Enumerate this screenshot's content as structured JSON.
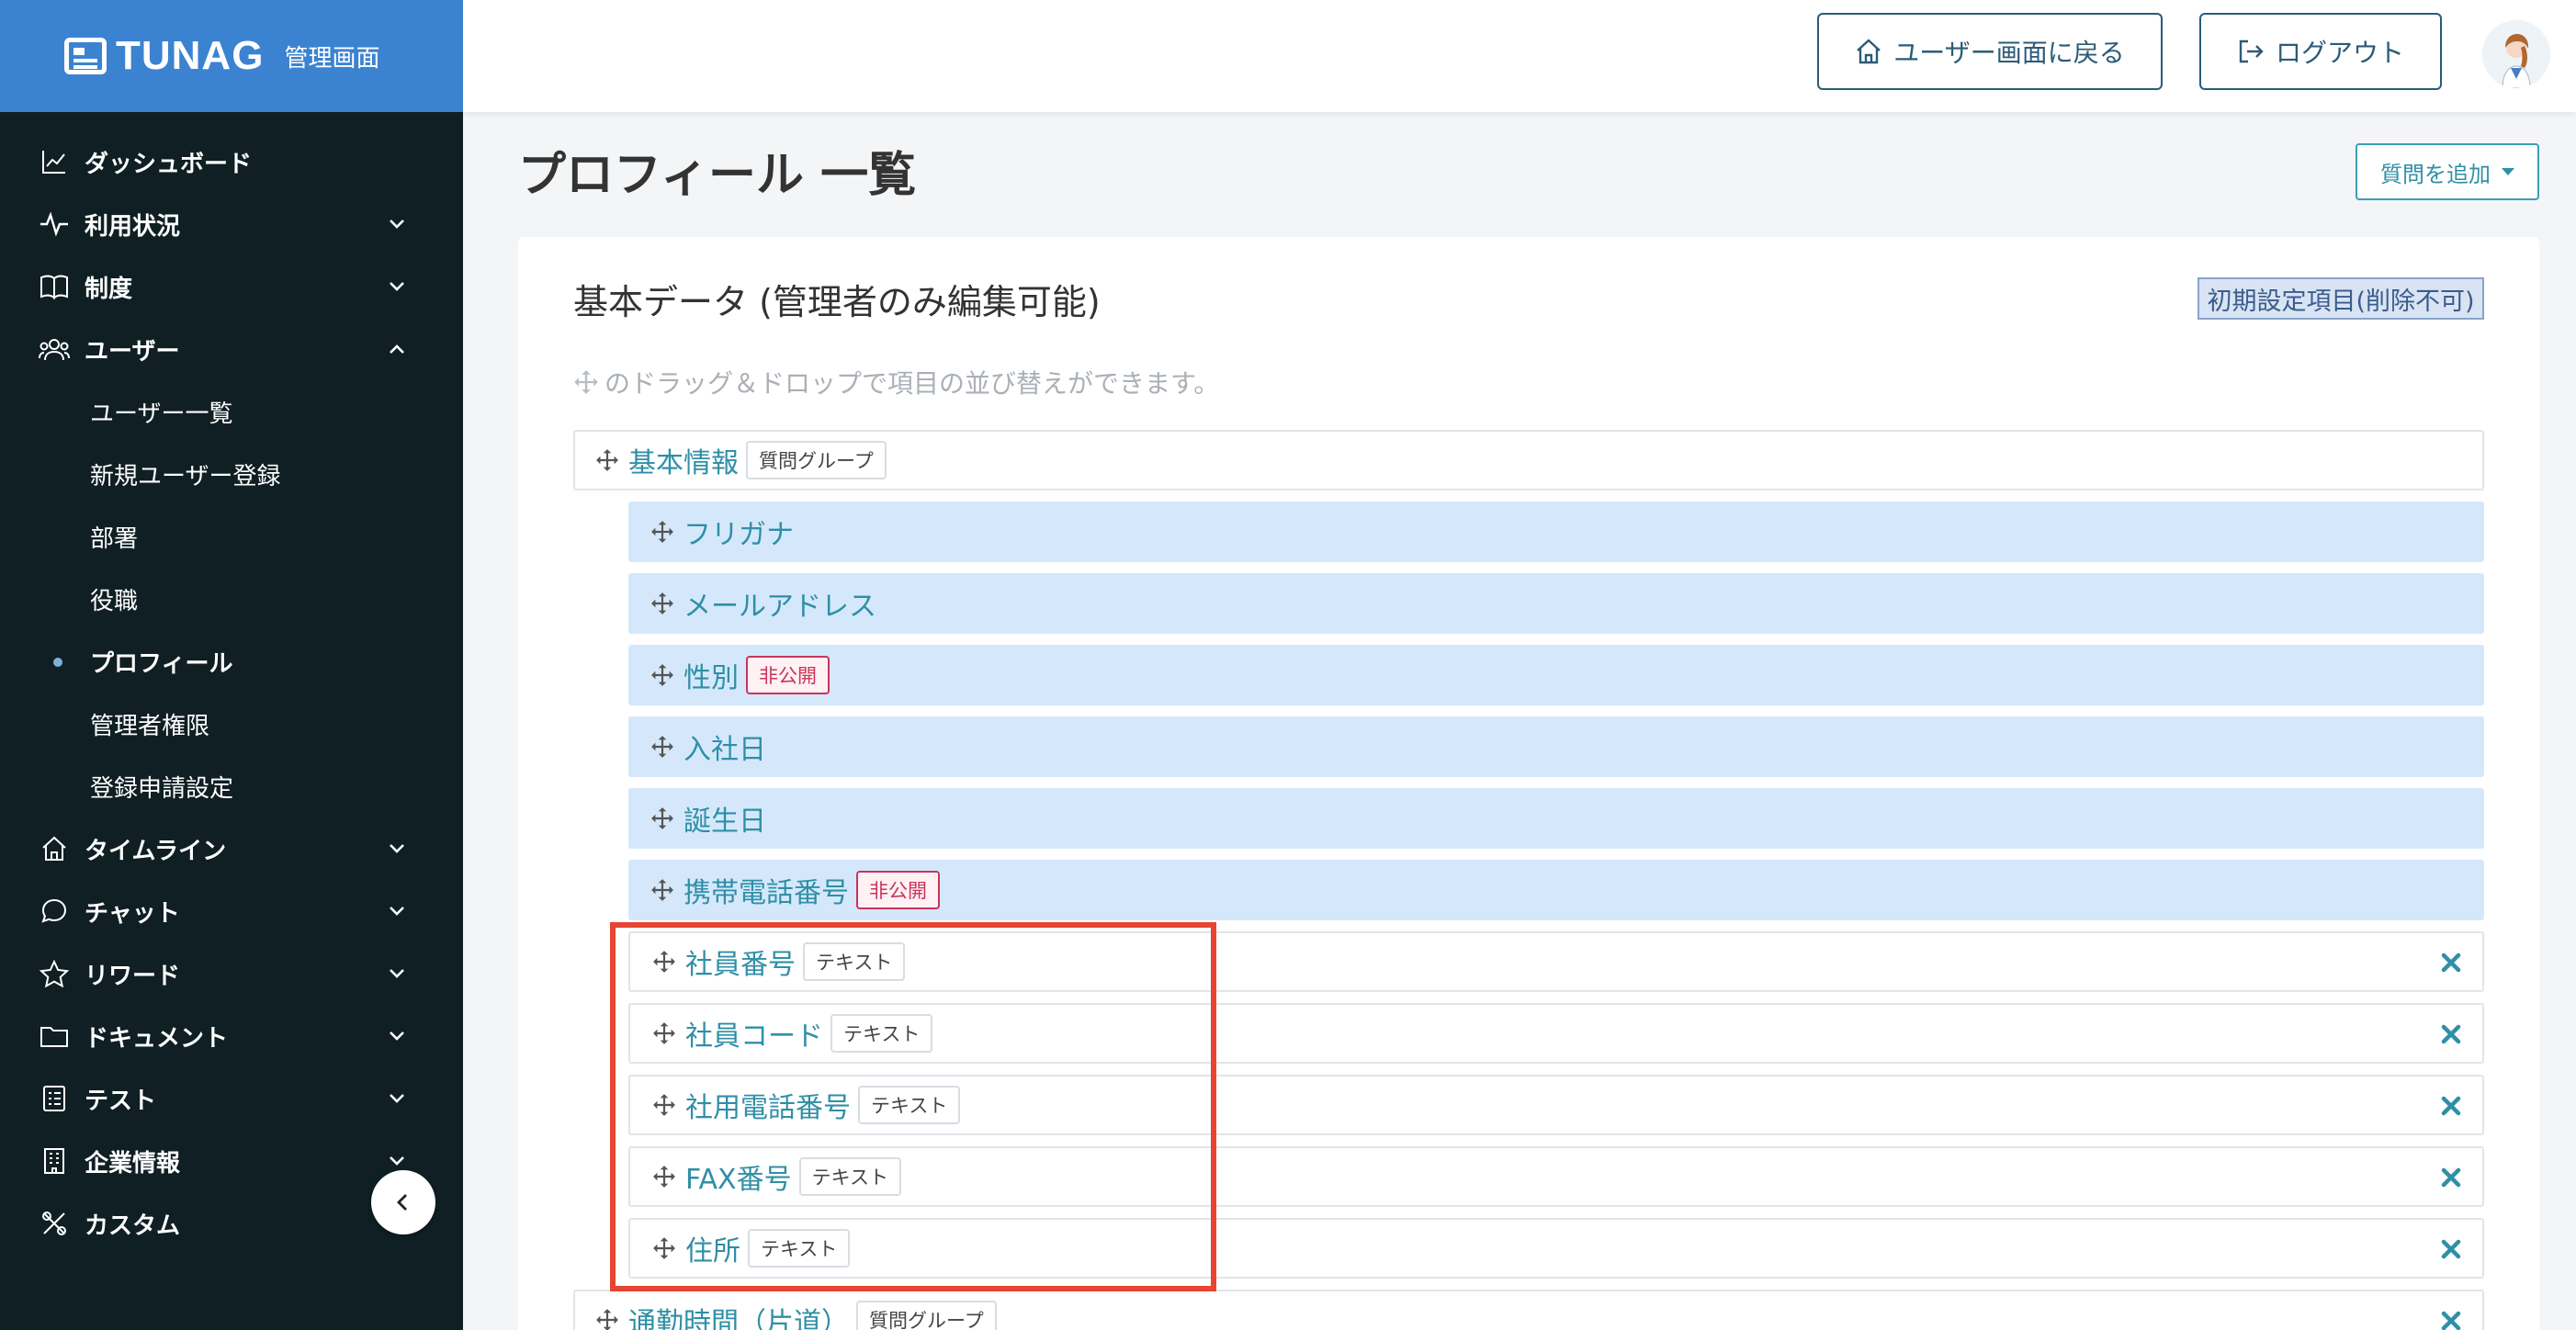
{
  "brand": {
    "logo": "TUNAG",
    "admin_label": "管理画面"
  },
  "header": {
    "back_button": "ユーザー画面に戻る",
    "logout_button": "ログアウト"
  },
  "sidebar": {
    "items": [
      {
        "label": "ダッシュボード",
        "icon": "chart-line-icon",
        "expandable": false
      },
      {
        "label": "利用状況",
        "icon": "activity-icon",
        "expandable": true
      },
      {
        "label": "制度",
        "icon": "book-icon",
        "expandable": true
      },
      {
        "label": "ユーザー",
        "icon": "users-icon",
        "expandable": true,
        "expanded": true
      }
    ],
    "user_sub": [
      {
        "label": "ユーザー一覧"
      },
      {
        "label": "新規ユーザー登録"
      },
      {
        "label": "部署"
      },
      {
        "label": "役職"
      },
      {
        "label": "プロフィール",
        "active": true
      },
      {
        "label": "管理者権限"
      },
      {
        "label": "登録申請設定"
      }
    ],
    "items_after": [
      {
        "label": "タイムライン",
        "icon": "home-icon",
        "expandable": true
      },
      {
        "label": "チャット",
        "icon": "chat-icon",
        "expandable": true
      },
      {
        "label": "リワード",
        "icon": "star-icon",
        "expandable": true
      },
      {
        "label": "ドキュメント",
        "icon": "folder-icon",
        "expandable": true
      },
      {
        "label": "テスト",
        "icon": "checklist-icon",
        "expandable": true
      },
      {
        "label": "企業情報",
        "icon": "building-icon",
        "expandable": true
      },
      {
        "label": "カスタム",
        "icon": "tools-icon",
        "expandable": false
      }
    ]
  },
  "main": {
    "title": "プロフィール 一覧",
    "add_question_button": "質問を追加",
    "card": {
      "title": "基本データ (管理者のみ編集可能)",
      "fixed_tag": "初期設定項目(削除不可)",
      "hint": "のドラッグ＆ドロップで項目の並び替えができます。",
      "group_badge": "質問グループ",
      "group_label": "基本情報",
      "private_badge": "非公開",
      "text_badge": "テキスト",
      "fixed_items": [
        "フリガナ",
        "メールアドレス",
        "性別",
        "入社日",
        "誕生日",
        "携帯電話番号"
      ],
      "custom_items": [
        "社員番号",
        "社員コード",
        "社用電話番号",
        "FAX番号",
        "住所"
      ],
      "next_group_label": "通勤時間（片道）"
    }
  },
  "colors": {
    "sidebar_bg": "#0f1f24",
    "brand_bg": "#3b83d1",
    "accent": "#2f8fa6",
    "highlight": "#e74432"
  }
}
